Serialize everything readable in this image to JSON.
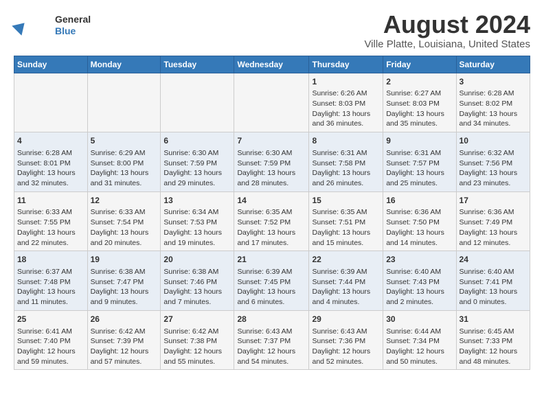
{
  "header": {
    "logo": {
      "line1": "General",
      "line2": "Blue"
    },
    "title": "August 2024",
    "subtitle": "Ville Platte, Louisiana, United States"
  },
  "calendar": {
    "days_of_week": [
      "Sunday",
      "Monday",
      "Tuesday",
      "Wednesday",
      "Thursday",
      "Friday",
      "Saturday"
    ],
    "weeks": [
      [
        {
          "day": "",
          "content": ""
        },
        {
          "day": "",
          "content": ""
        },
        {
          "day": "",
          "content": ""
        },
        {
          "day": "",
          "content": ""
        },
        {
          "day": "1",
          "content": "Sunrise: 6:26 AM\nSunset: 8:03 PM\nDaylight: 13 hours\nand 36 minutes."
        },
        {
          "day": "2",
          "content": "Sunrise: 6:27 AM\nSunset: 8:03 PM\nDaylight: 13 hours\nand 35 minutes."
        },
        {
          "day": "3",
          "content": "Sunrise: 6:28 AM\nSunset: 8:02 PM\nDaylight: 13 hours\nand 34 minutes."
        }
      ],
      [
        {
          "day": "4",
          "content": "Sunrise: 6:28 AM\nSunset: 8:01 PM\nDaylight: 13 hours\nand 32 minutes."
        },
        {
          "day": "5",
          "content": "Sunrise: 6:29 AM\nSunset: 8:00 PM\nDaylight: 13 hours\nand 31 minutes."
        },
        {
          "day": "6",
          "content": "Sunrise: 6:30 AM\nSunset: 7:59 PM\nDaylight: 13 hours\nand 29 minutes."
        },
        {
          "day": "7",
          "content": "Sunrise: 6:30 AM\nSunset: 7:59 PM\nDaylight: 13 hours\nand 28 minutes."
        },
        {
          "day": "8",
          "content": "Sunrise: 6:31 AM\nSunset: 7:58 PM\nDaylight: 13 hours\nand 26 minutes."
        },
        {
          "day": "9",
          "content": "Sunrise: 6:31 AM\nSunset: 7:57 PM\nDaylight: 13 hours\nand 25 minutes."
        },
        {
          "day": "10",
          "content": "Sunrise: 6:32 AM\nSunset: 7:56 PM\nDaylight: 13 hours\nand 23 minutes."
        }
      ],
      [
        {
          "day": "11",
          "content": "Sunrise: 6:33 AM\nSunset: 7:55 PM\nDaylight: 13 hours\nand 22 minutes."
        },
        {
          "day": "12",
          "content": "Sunrise: 6:33 AM\nSunset: 7:54 PM\nDaylight: 13 hours\nand 20 minutes."
        },
        {
          "day": "13",
          "content": "Sunrise: 6:34 AM\nSunset: 7:53 PM\nDaylight: 13 hours\nand 19 minutes."
        },
        {
          "day": "14",
          "content": "Sunrise: 6:35 AM\nSunset: 7:52 PM\nDaylight: 13 hours\nand 17 minutes."
        },
        {
          "day": "15",
          "content": "Sunrise: 6:35 AM\nSunset: 7:51 PM\nDaylight: 13 hours\nand 15 minutes."
        },
        {
          "day": "16",
          "content": "Sunrise: 6:36 AM\nSunset: 7:50 PM\nDaylight: 13 hours\nand 14 minutes."
        },
        {
          "day": "17",
          "content": "Sunrise: 6:36 AM\nSunset: 7:49 PM\nDaylight: 13 hours\nand 12 minutes."
        }
      ],
      [
        {
          "day": "18",
          "content": "Sunrise: 6:37 AM\nSunset: 7:48 PM\nDaylight: 13 hours\nand 11 minutes."
        },
        {
          "day": "19",
          "content": "Sunrise: 6:38 AM\nSunset: 7:47 PM\nDaylight: 13 hours\nand 9 minutes."
        },
        {
          "day": "20",
          "content": "Sunrise: 6:38 AM\nSunset: 7:46 PM\nDaylight: 13 hours\nand 7 minutes."
        },
        {
          "day": "21",
          "content": "Sunrise: 6:39 AM\nSunset: 7:45 PM\nDaylight: 13 hours\nand 6 minutes."
        },
        {
          "day": "22",
          "content": "Sunrise: 6:39 AM\nSunset: 7:44 PM\nDaylight: 13 hours\nand 4 minutes."
        },
        {
          "day": "23",
          "content": "Sunrise: 6:40 AM\nSunset: 7:43 PM\nDaylight: 13 hours\nand 2 minutes."
        },
        {
          "day": "24",
          "content": "Sunrise: 6:40 AM\nSunset: 7:41 PM\nDaylight: 13 hours\nand 0 minutes."
        }
      ],
      [
        {
          "day": "25",
          "content": "Sunrise: 6:41 AM\nSunset: 7:40 PM\nDaylight: 12 hours\nand 59 minutes."
        },
        {
          "day": "26",
          "content": "Sunrise: 6:42 AM\nSunset: 7:39 PM\nDaylight: 12 hours\nand 57 minutes."
        },
        {
          "day": "27",
          "content": "Sunrise: 6:42 AM\nSunset: 7:38 PM\nDaylight: 12 hours\nand 55 minutes."
        },
        {
          "day": "28",
          "content": "Sunrise: 6:43 AM\nSunset: 7:37 PM\nDaylight: 12 hours\nand 54 minutes."
        },
        {
          "day": "29",
          "content": "Sunrise: 6:43 AM\nSunset: 7:36 PM\nDaylight: 12 hours\nand 52 minutes."
        },
        {
          "day": "30",
          "content": "Sunrise: 6:44 AM\nSunset: 7:34 PM\nDaylight: 12 hours\nand 50 minutes."
        },
        {
          "day": "31",
          "content": "Sunrise: 6:45 AM\nSunset: 7:33 PM\nDaylight: 12 hours\nand 48 minutes."
        }
      ]
    ]
  }
}
